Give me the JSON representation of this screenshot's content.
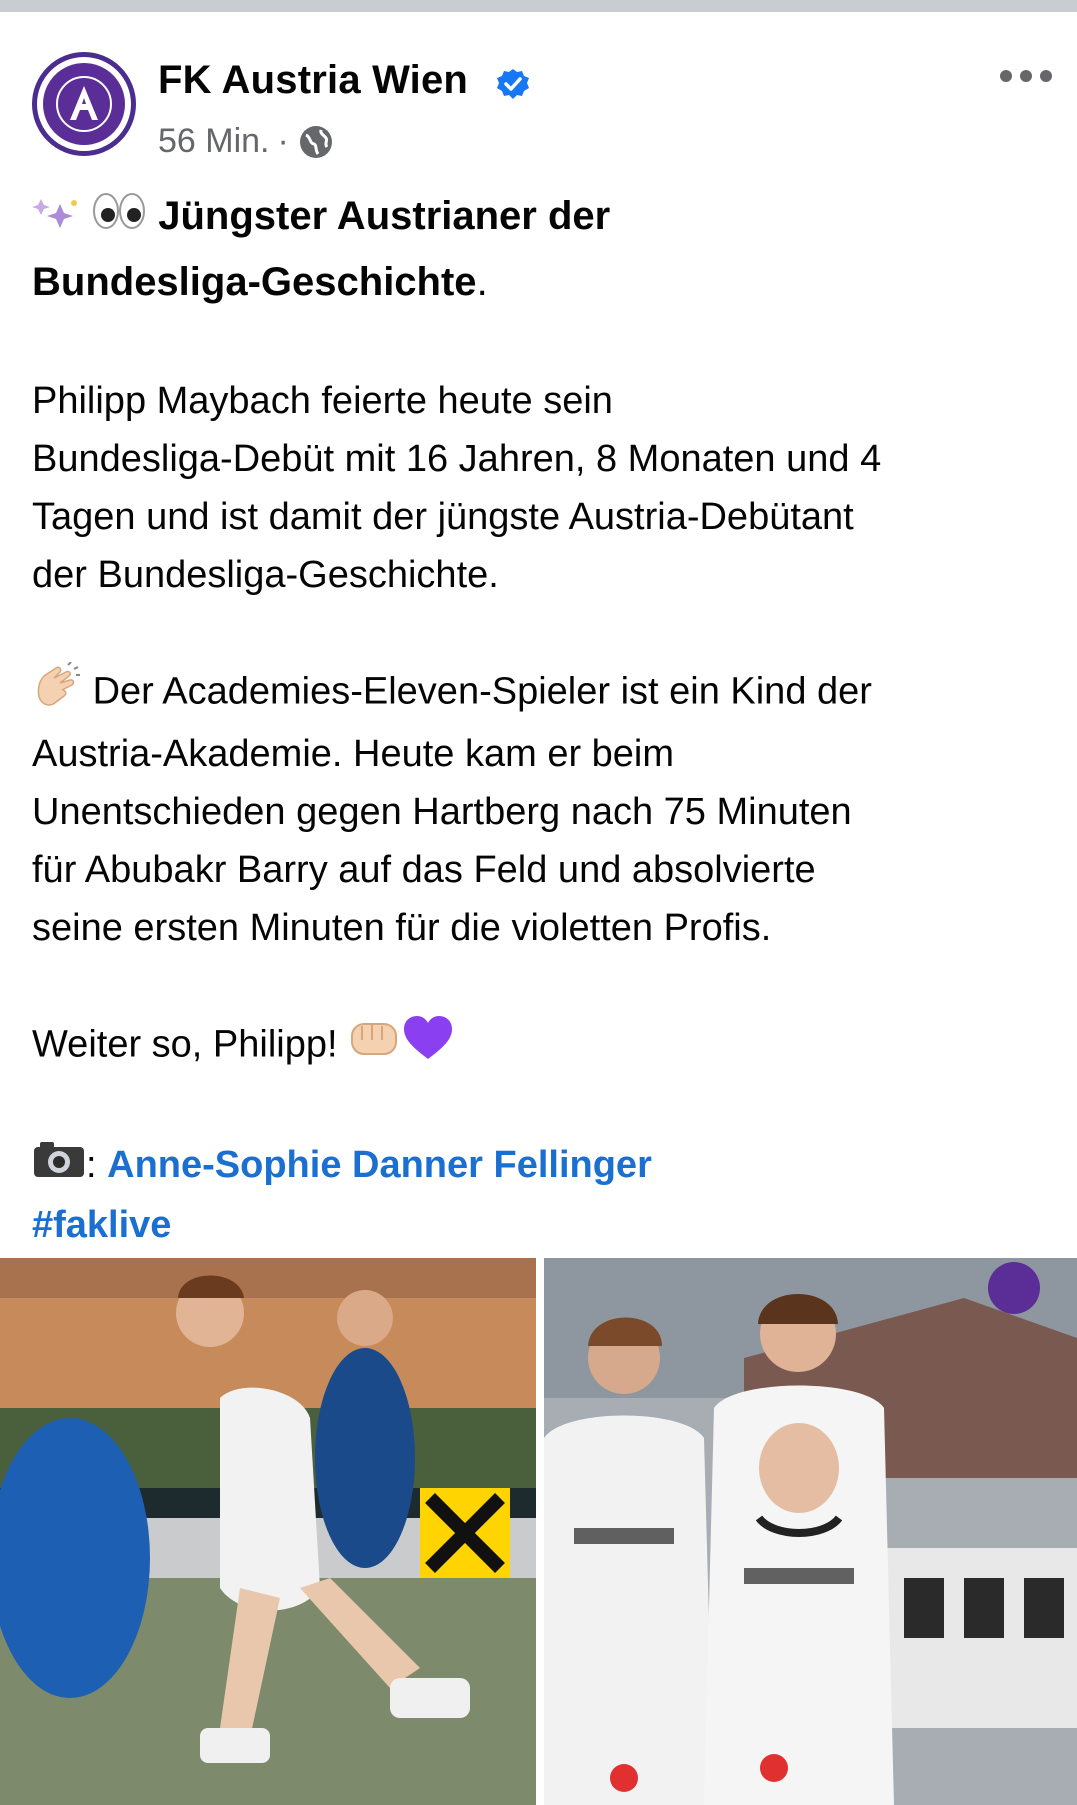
{
  "post": {
    "author": "FK Austria Wien",
    "time": "56 Min.",
    "separator": "·",
    "headline_part1": "Jüngster Austrianer der",
    "headline_part2": "Bundesliga-Geschichte",
    "headline_punct": ".",
    "para1": [
      "Philipp Maybach feierte heute sein",
      "Bundesliga-Debüt mit 16 Jahren, 8 Monaten und 4",
      "Tagen und ist damit der jüngste Austria-Debütant",
      "der Bundesliga-Geschichte."
    ],
    "para2": [
      "Der Academies-Eleven-Spieler ist ein Kind der",
      "Austria-Akademie. Heute kam er beim",
      "Unentschieden gegen Hartberg nach 75 Minuten",
      "für Abubakr Barry auf das Feld und absolvierte",
      "seine ersten Minuten für die violetten Profis."
    ],
    "para3": "Weiter so, Philipp!",
    "credit_sep": ":",
    "credit_name": "Anne-Sophie Danner Fellinger",
    "hashtag": "#faklive"
  },
  "photos": [
    {
      "alt": "player-action-photo"
    },
    {
      "alt": "players-applauding-photo"
    }
  ],
  "colors": {
    "accent_link": "#1b6fd0",
    "verified": "#1877f2",
    "club_violet": "#5b2d97",
    "meta_gray": "#65676b"
  },
  "icons": [
    "verified-badge-icon",
    "globe-icon",
    "more-options-icon",
    "sparkles-emoji",
    "eyes-emoji",
    "clapping-hands-emoji",
    "fist-emoji",
    "purple-heart-emoji",
    "camera-emoji"
  ]
}
